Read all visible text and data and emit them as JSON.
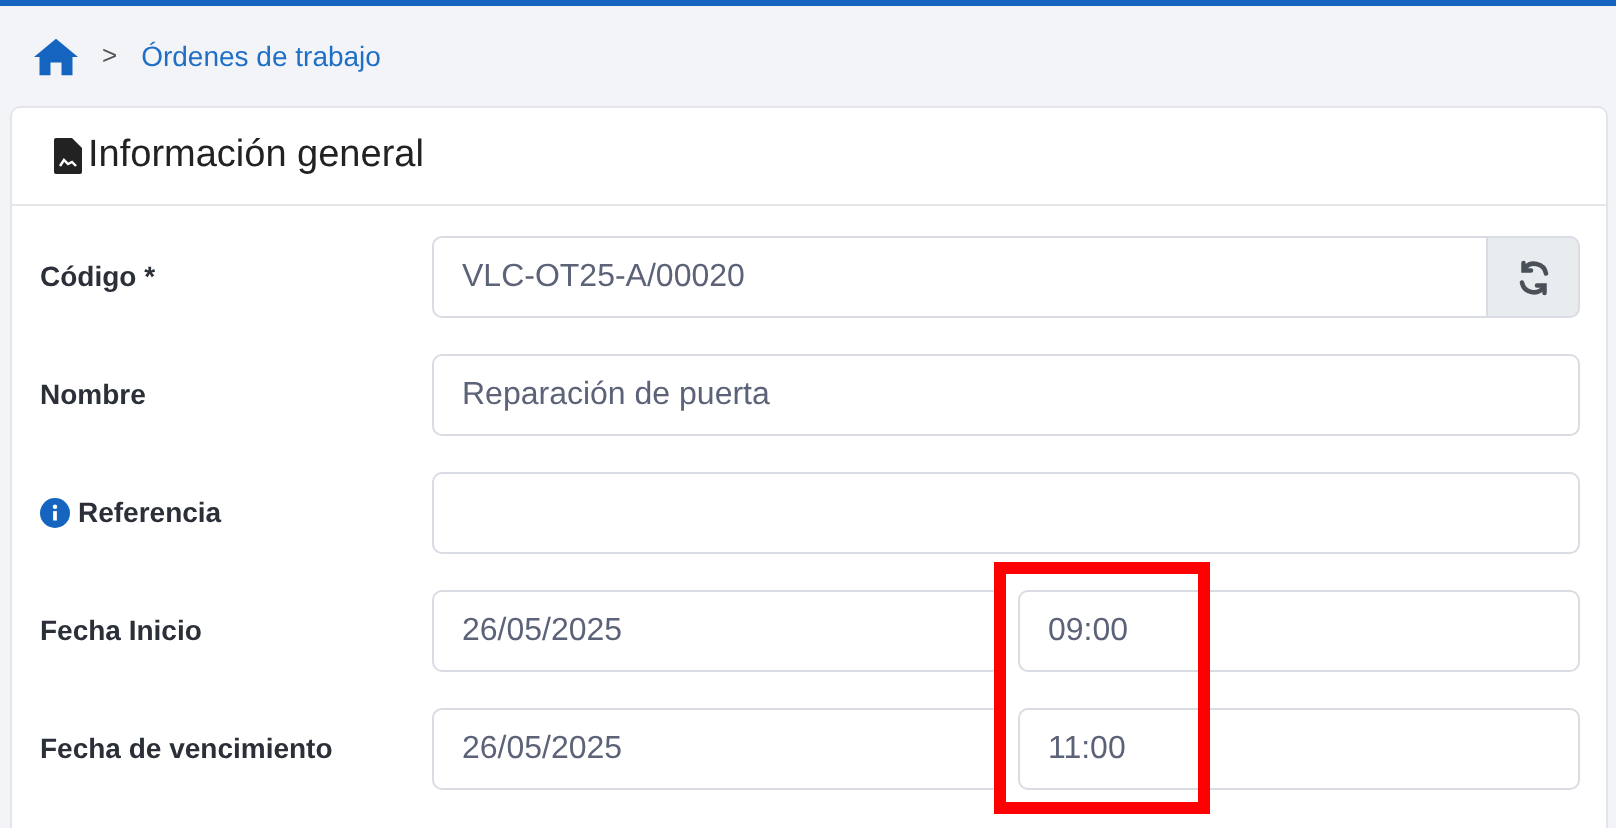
{
  "breadcrumb": {
    "separator": ">",
    "items": [
      "Órdenes de trabajo"
    ]
  },
  "card": {
    "title": "Información general"
  },
  "fields": [
    {
      "kind": "code",
      "label": "Código *",
      "value": "VLC-OT25-A/00020",
      "highlighted": false
    },
    {
      "kind": "text",
      "label": "Nombre",
      "value": "Reparación de puerta",
      "highlighted": false
    },
    {
      "kind": "info",
      "label": "Referencia",
      "highlighted": false
    },
    {
      "kind": "datetime",
      "label": "Fecha Inicio",
      "value": "26/05/2025",
      "time": "09:00",
      "highlighted": true
    },
    {
      "kind": "datetime",
      "label": "Fecha de vencimiento",
      "value": "26/05/2025",
      "time": "11:00",
      "highlighted": true
    }
  ]
}
